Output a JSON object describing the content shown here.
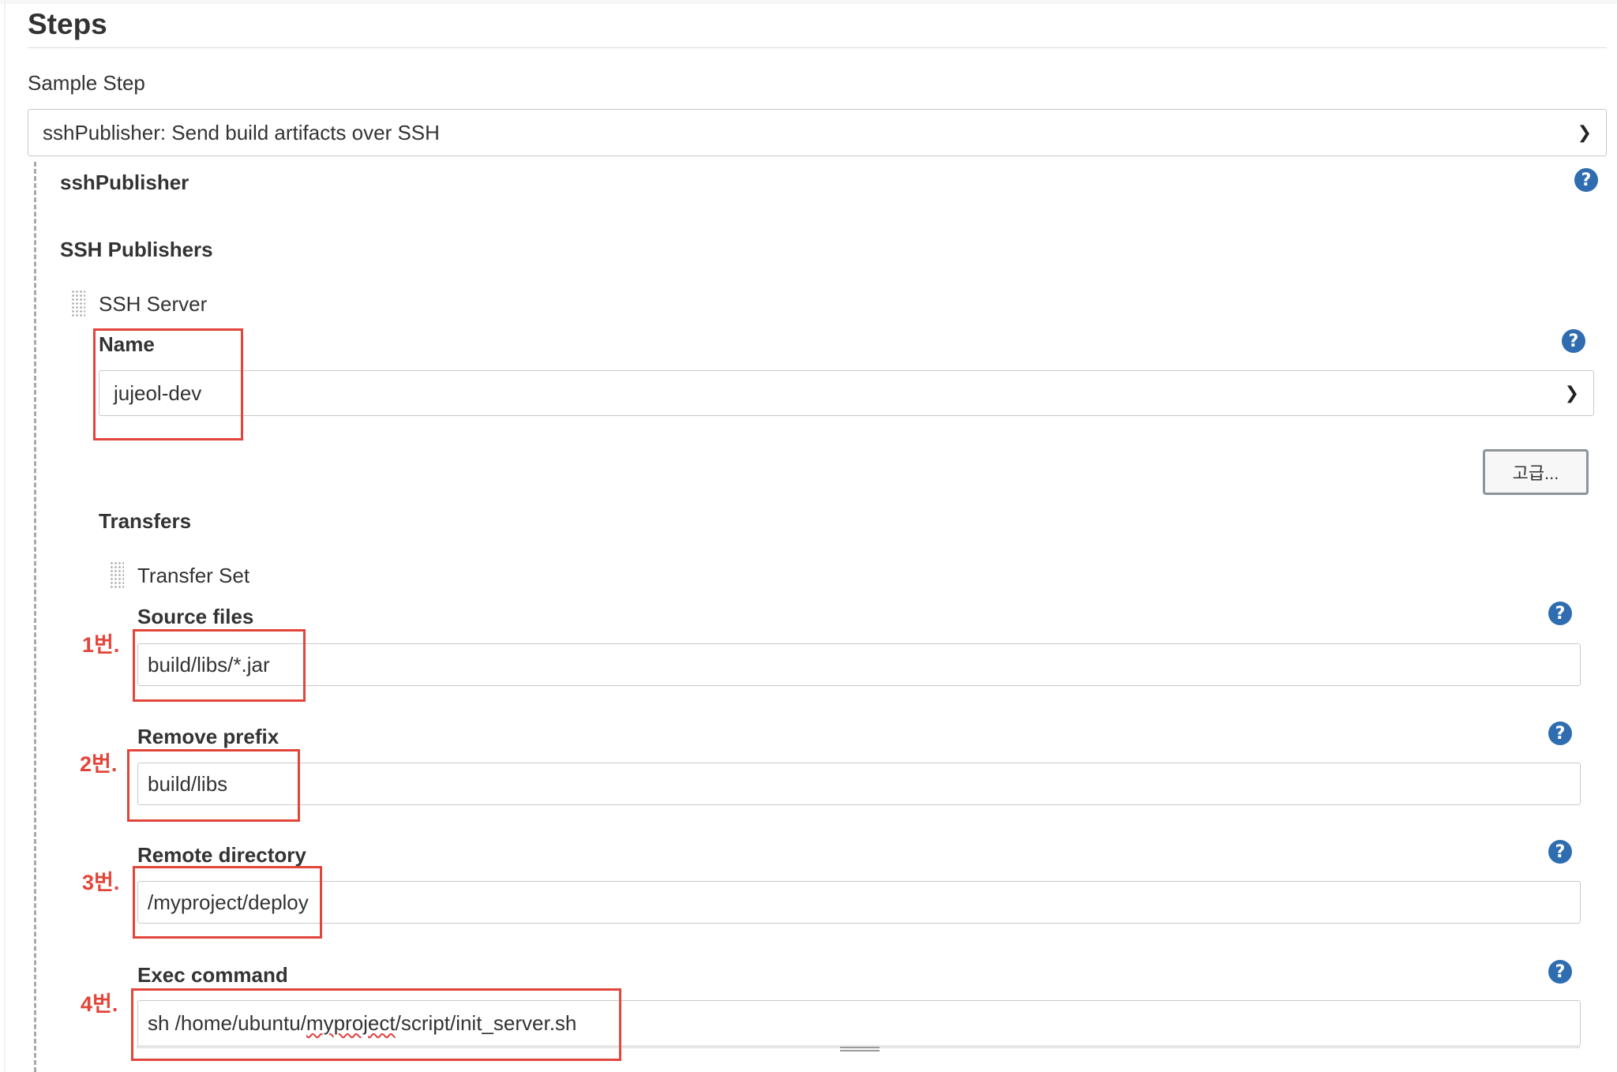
{
  "steps": {
    "title": "Steps",
    "sample_step_label": "Sample Step",
    "sample_step_value": "sshPublisher: Send build artifacts over SSH"
  },
  "ssh_publisher": {
    "title": "sshPublisher",
    "publishers_label": "SSH Publishers",
    "server_label": "SSH Server",
    "name_label": "Name",
    "name_value": "jujeol-dev",
    "advanced_button": "고급...",
    "transfers_label": "Transfers",
    "transfer_set_label": "Transfer Set",
    "fields": {
      "source_files": {
        "label": "Source files",
        "value": "build/libs/*.jar",
        "marker": "1번."
      },
      "remove_prefix": {
        "label": "Remove prefix",
        "value": "build/libs",
        "marker": "2번."
      },
      "remote_directory": {
        "label": "Remote directory",
        "value": "/myproject/deploy",
        "marker": "3번."
      },
      "exec_command": {
        "label": "Exec command",
        "value_before": "sh /home/ubuntu/",
        "value_misspelled": "myproject",
        "value_after": "/script/init_server.sh",
        "marker": "4번."
      }
    }
  },
  "icons": {
    "help": "help-icon",
    "chevron": "chevron-down-icon",
    "grip": "drag-handle-icon"
  },
  "colors": {
    "annotation": "#e2453a",
    "help": "#2f6db0"
  }
}
